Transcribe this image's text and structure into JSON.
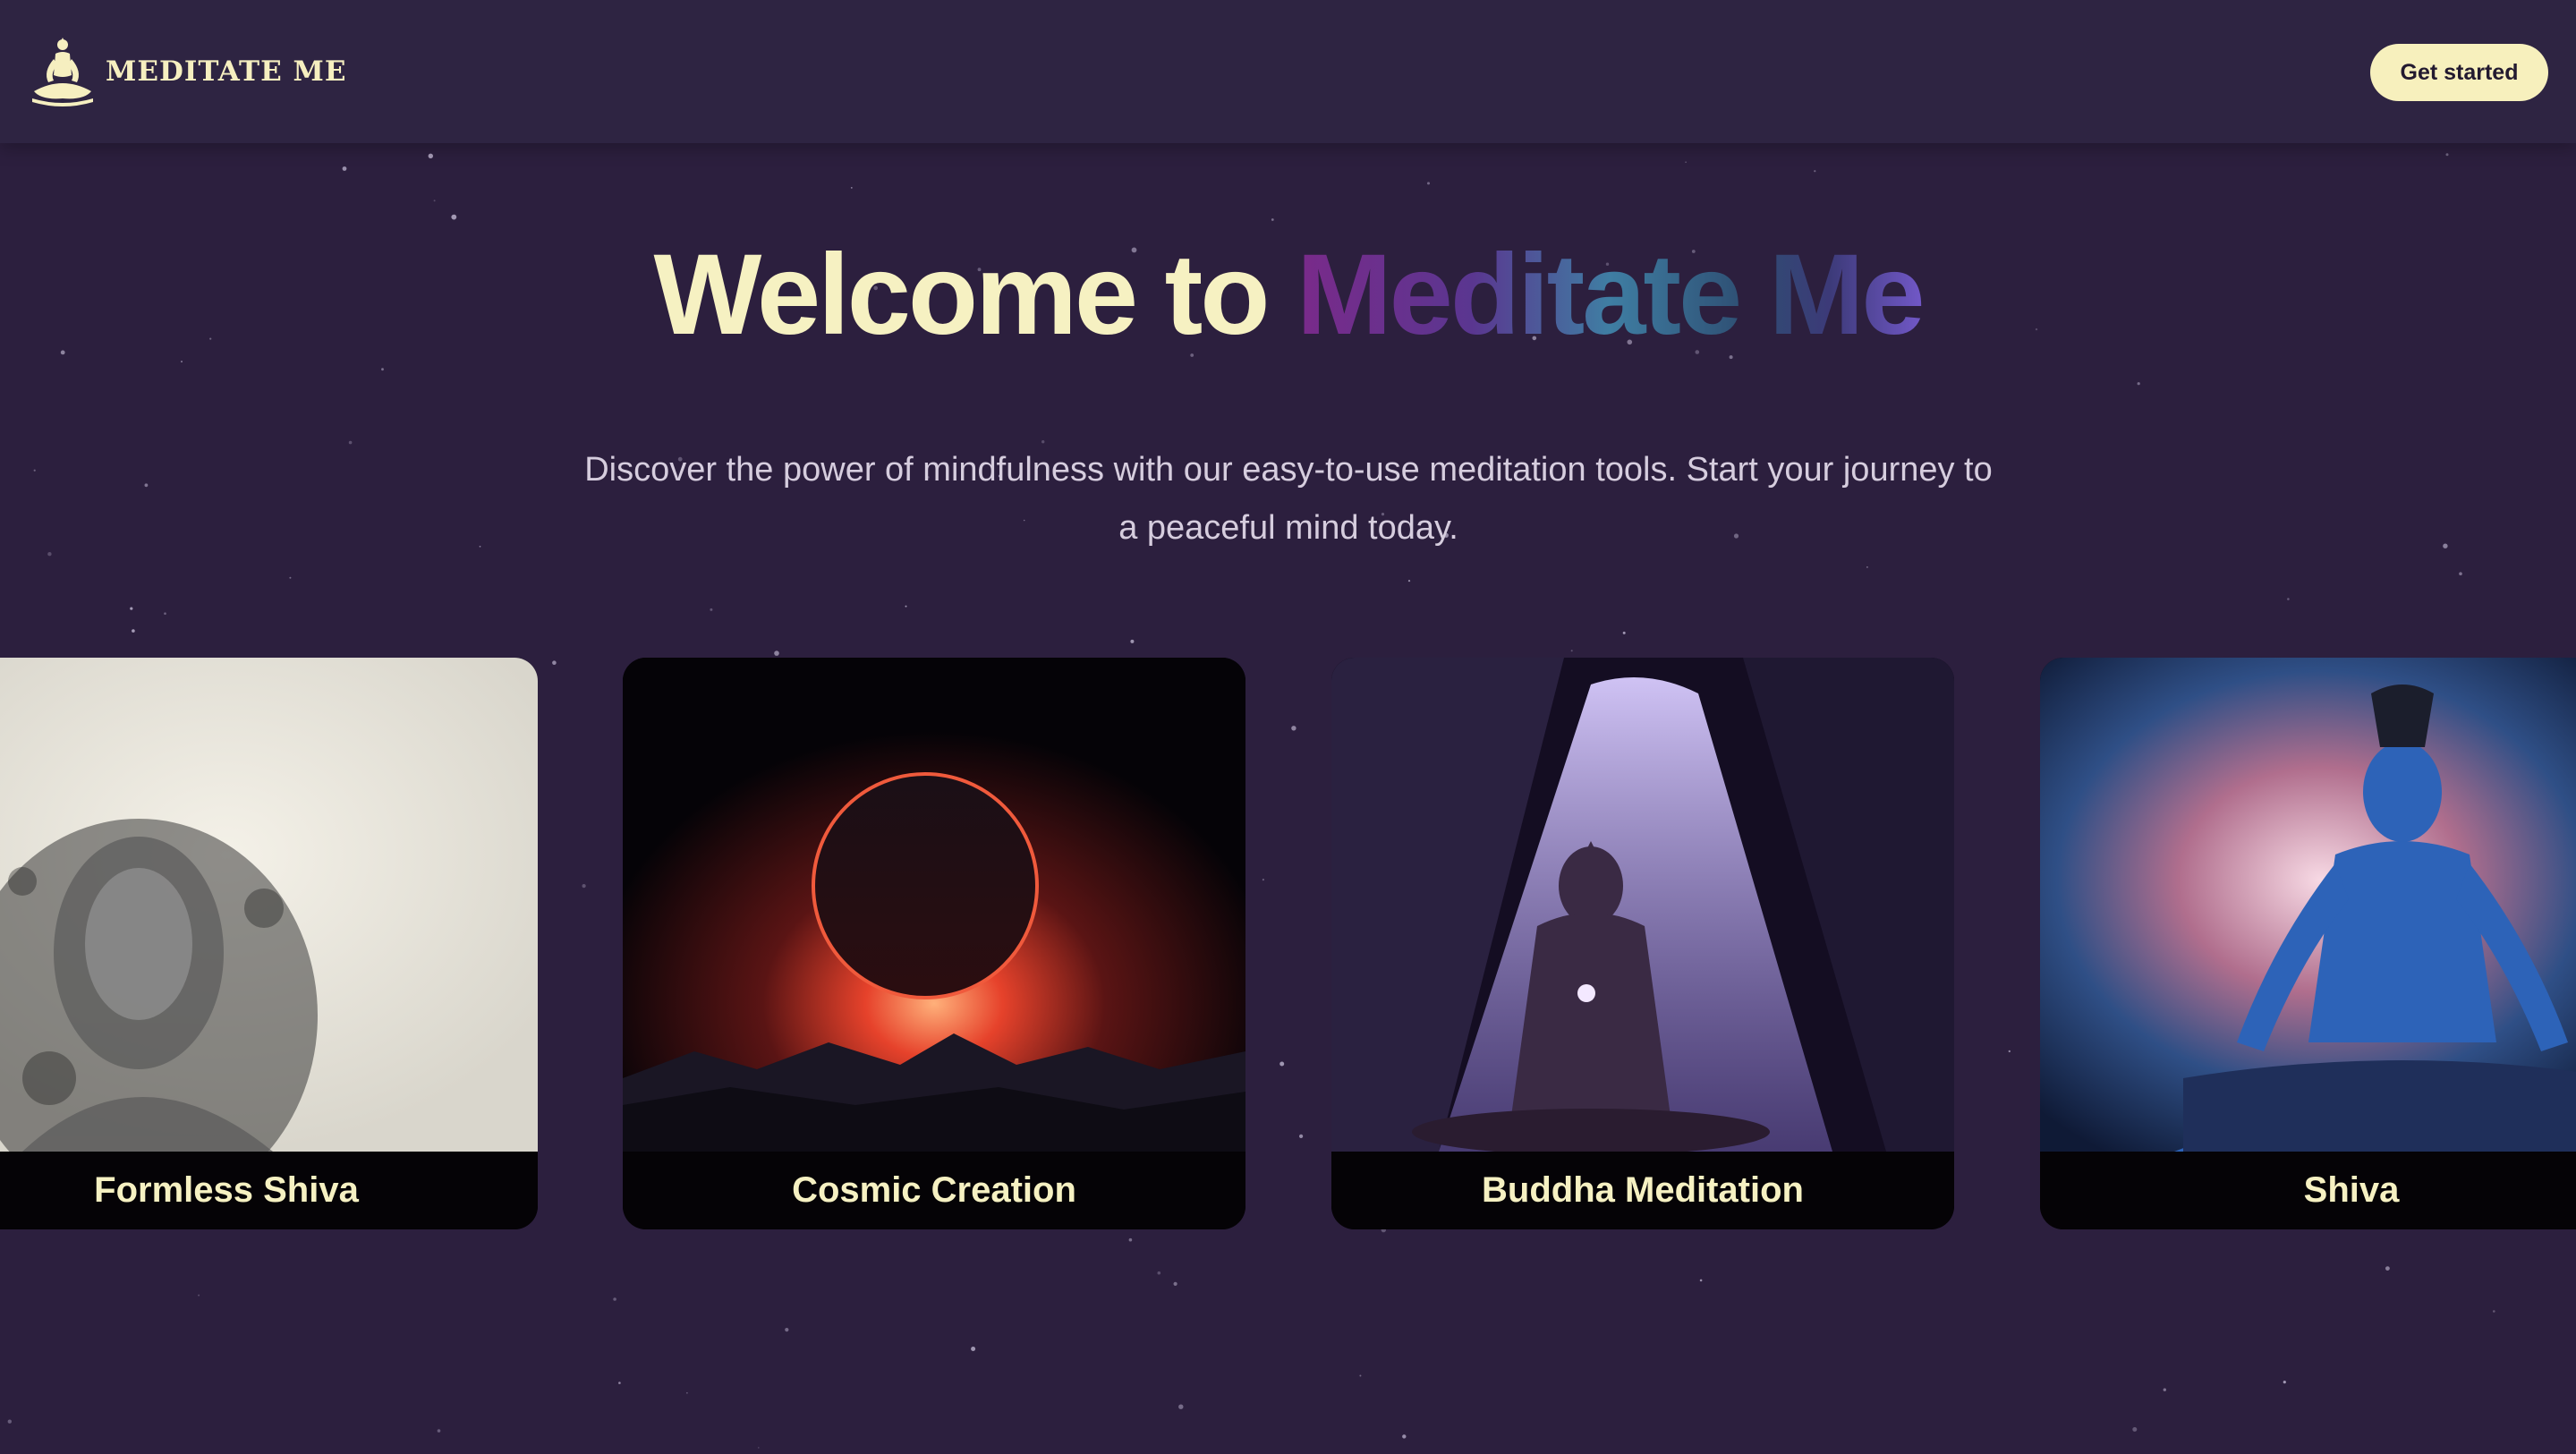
{
  "header": {
    "logo_text": "MEDITATE ME",
    "logo_icon": "meditating-figure-icon",
    "cta_label": "Get started"
  },
  "hero": {
    "title_plain": "Welcome to",
    "title_gradient": "Meditate Me",
    "subtitle": "Discover the power of mindfulness with our easy-to-use meditation tools. Start your journey to a peaceful mind today."
  },
  "cards": [
    {
      "title": "Formless Shiva"
    },
    {
      "title": "Cosmic Creation"
    },
    {
      "title": "Buddha Meditation"
    },
    {
      "title": "Shiva"
    }
  ],
  "colors": {
    "background": "#2c1f3e",
    "navbar": "#2e2442",
    "accent_cream": "#f7f0bd"
  }
}
